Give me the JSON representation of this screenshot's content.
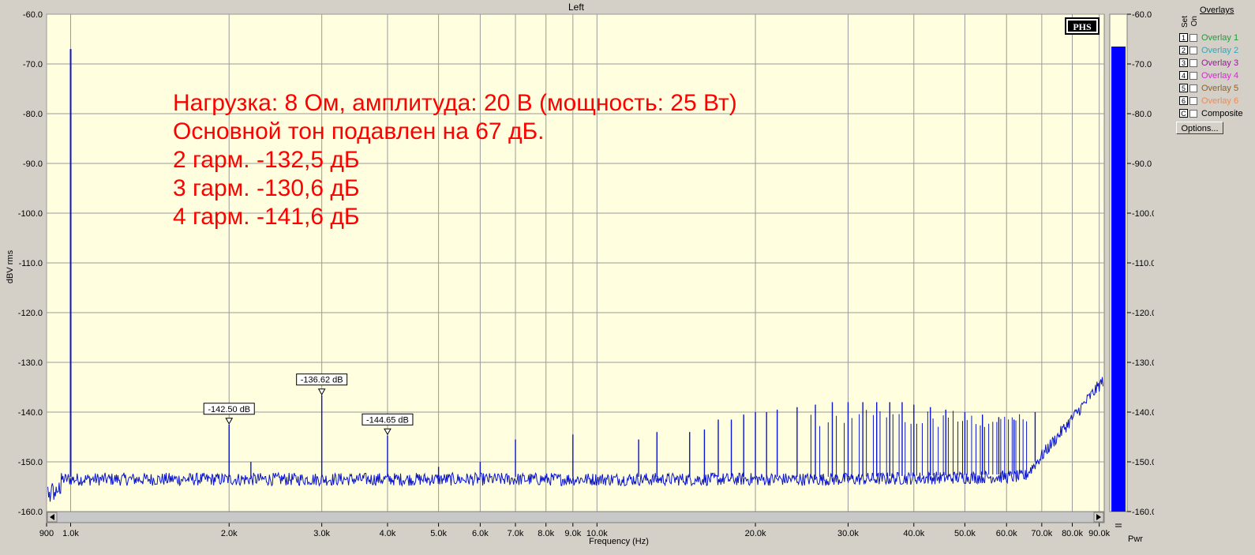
{
  "window": {
    "title": "Left"
  },
  "overlays": {
    "title": "Overlays",
    "set_header": "Set",
    "on_header": "On",
    "items": [
      {
        "key": "1",
        "label": "Overlay 1",
        "color": "#1f9a3a"
      },
      {
        "key": "2",
        "label": "Overlay 2",
        "color": "#2aa8c0"
      },
      {
        "key": "3",
        "label": "Overlay 3",
        "color": "#9a189a"
      },
      {
        "key": "4",
        "label": "Overlay 4",
        "color": "#e020e0"
      },
      {
        "key": "5",
        "label": "Overlay 5",
        "color": "#8a6030"
      },
      {
        "key": "6",
        "label": "Overlay 6",
        "color": "#f08a50"
      },
      {
        "key": "C",
        "label": "Composite",
        "color": "#000000"
      }
    ],
    "options_label": "Options..."
  },
  "pwr": {
    "label": "Pwr",
    "level_db": -66.5
  },
  "chart_data": {
    "type": "line",
    "title": "",
    "xlabel": "Frequency (Hz)",
    "ylabel": "dBV rms",
    "x_scale": "log",
    "xlim": [
      900,
      92000
    ],
    "ylim": [
      -160,
      -60
    ],
    "grid": true,
    "x_ticks": [
      900,
      1000,
      2000,
      3000,
      4000,
      5000,
      6000,
      7000,
      8000,
      9000,
      10000,
      20000,
      30000,
      40000,
      50000,
      60000,
      70000,
      80000,
      90000
    ],
    "x_tick_labels": [
      "900",
      "1.0k",
      "2.0k",
      "3.0k",
      "4.0k",
      "5.0k",
      "6.0k",
      "7.0k",
      "8.0k",
      "9.0k",
      "10.0k",
      "20.0k",
      "30.0k",
      "40.0k",
      "50.0k",
      "60.0k",
      "70.0k",
      "80.0k",
      "90.0k"
    ],
    "y_ticks": [
      -60,
      -70,
      -80,
      -90,
      -100,
      -110,
      -120,
      -130,
      -140,
      -150,
      -160
    ],
    "y_tick_labels": [
      "-60.0",
      "-70.0",
      "-80.0",
      "-90.0",
      "-100.0",
      "-110.0",
      "-120.0",
      "-130.0",
      "-140.0",
      "-150.0",
      "-160.0"
    ],
    "series": [
      {
        "color": "#0a14cc",
        "noise_floor_db": -153.5,
        "peaks": [
          {
            "x": 1000,
            "y": -67.0
          },
          {
            "x": 2000,
            "y": -142.5
          },
          {
            "x": 2200,
            "y": -150.0
          },
          {
            "x": 3000,
            "y": -136.6
          },
          {
            "x": 4000,
            "y": -144.7
          },
          {
            "x": 5000,
            "y": -151.0
          },
          {
            "x": 6000,
            "y": -150.0
          },
          {
            "x": 7000,
            "y": -145.5
          },
          {
            "x": 9000,
            "y": -144.5
          },
          {
            "x": 12000,
            "y": -145.5
          },
          {
            "x": 13000,
            "y": -144.0
          },
          {
            "x": 15000,
            "y": -144.0
          },
          {
            "x": 16000,
            "y": -143.5
          },
          {
            "x": 17000,
            "y": -141.5
          },
          {
            "x": 18000,
            "y": -141.5
          },
          {
            "x": 19000,
            "y": -140.5
          },
          {
            "x": 20000,
            "y": -140.0
          },
          {
            "x": 21000,
            "y": -140.0
          },
          {
            "x": 22000,
            "y": -139.5
          },
          {
            "x": 24000,
            "y": -139.0
          },
          {
            "x": 26000,
            "y": -138.5
          },
          {
            "x": 28000,
            "y": -138.0
          },
          {
            "x": 30000,
            "y": -138.0
          },
          {
            "x": 32000,
            "y": -138.0
          },
          {
            "x": 34000,
            "y": -138.0
          },
          {
            "x": 36000,
            "y": -138.0
          },
          {
            "x": 38000,
            "y": -138.0
          },
          {
            "x": 40000,
            "y": -138.5
          },
          {
            "x": 43000,
            "y": -139.0
          },
          {
            "x": 46000,
            "y": -139.5
          },
          {
            "x": 50000,
            "y": -140.0
          },
          {
            "x": 54000,
            "y": -140.5
          },
          {
            "x": 58000,
            "y": -141.0
          },
          {
            "x": 62000,
            "y": -141.5
          },
          {
            "x": 68000,
            "y": -140.0
          }
        ]
      }
    ],
    "markers": [
      {
        "x": 2000,
        "y": -142.5,
        "label": "-142.50 dB"
      },
      {
        "x": 3000,
        "y": -136.62,
        "label": "-136.62 dB"
      },
      {
        "x": 4000,
        "y": -144.65,
        "label": "-144.65 dB"
      }
    ],
    "annotation_lines": [
      "Нагрузка: 8 Ом, амплитуда: 20 В (мощность: 25 Вт)",
      "Основной тон подавлен на 67 дБ.",
      "2 гарм. -132,5 дБ",
      "3 гарм. -130,6 дБ",
      "4 гарм. -141,6 дБ"
    ],
    "annotation_color": "#ff0000",
    "logo_text": "PHS"
  }
}
